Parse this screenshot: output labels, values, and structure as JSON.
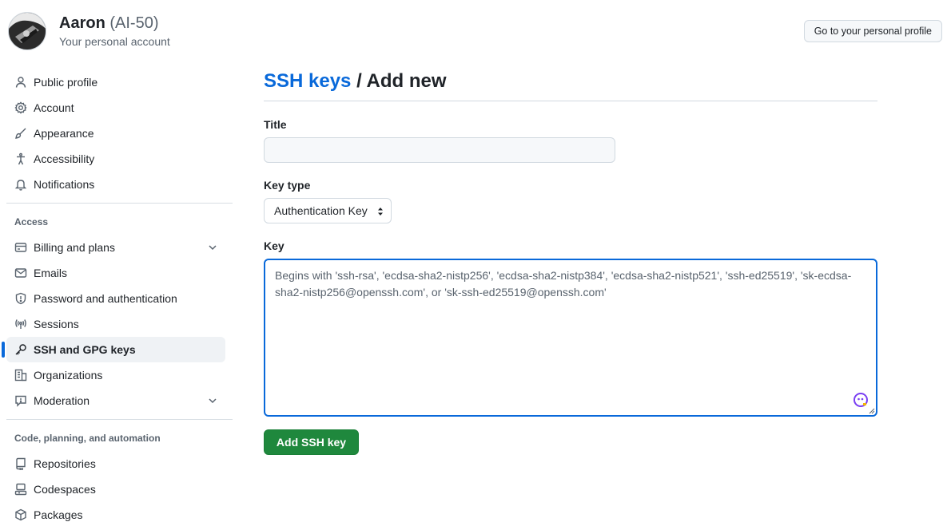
{
  "account": {
    "name": "Aaron",
    "org": "(AI-50)",
    "subtitle": "Your personal account",
    "profile_button": "Go to your personal profile"
  },
  "sidebar": {
    "top_items": [
      {
        "label": "Public profile",
        "icon": "person-icon"
      },
      {
        "label": "Account",
        "icon": "gear-icon"
      },
      {
        "label": "Appearance",
        "icon": "paintbrush-icon"
      },
      {
        "label": "Accessibility",
        "icon": "accessibility-icon"
      },
      {
        "label": "Notifications",
        "icon": "bell-icon"
      }
    ],
    "access_heading": "Access",
    "access_items": [
      {
        "label": "Billing and plans",
        "icon": "credit-card-icon",
        "expandable": true
      },
      {
        "label": "Emails",
        "icon": "mail-icon"
      },
      {
        "label": "Password and authentication",
        "icon": "shield-icon"
      },
      {
        "label": "Sessions",
        "icon": "broadcast-icon"
      },
      {
        "label": "SSH and GPG keys",
        "icon": "key-icon",
        "active": true
      },
      {
        "label": "Organizations",
        "icon": "organization-icon"
      },
      {
        "label": "Moderation",
        "icon": "report-icon",
        "expandable": true
      }
    ],
    "code_heading": "Code, planning, and automation",
    "code_items": [
      {
        "label": "Repositories",
        "icon": "repo-icon"
      },
      {
        "label": "Codespaces",
        "icon": "codespaces-icon"
      },
      {
        "label": "Packages",
        "icon": "package-icon"
      }
    ]
  },
  "main": {
    "breadcrumb": "SSH keys",
    "separator": " / ",
    "title": "Add new",
    "title_label": "Title",
    "title_value": "",
    "key_type_label": "Key type",
    "key_type_selected": "Authentication Key",
    "key_label": "Key",
    "key_placeholder": "Begins with 'ssh-rsa', 'ecdsa-sha2-nistp256', 'ecdsa-sha2-nistp384', 'ecdsa-sha2-nistp521', 'ssh-ed25519', 'sk-ecdsa-sha2-nistp256@openssh.com', or 'sk-ssh-ed25519@openssh.com'",
    "submit_label": "Add SSH key"
  },
  "colors": {
    "accent": "#0969da",
    "primary_button": "#1f883d",
    "active_bg": "#eff2f5"
  }
}
